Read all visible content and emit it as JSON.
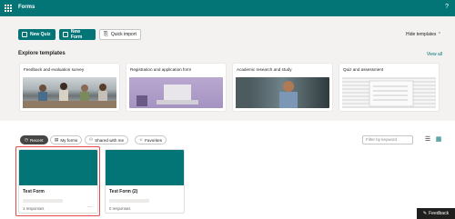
{
  "app": {
    "title": "Forms"
  },
  "toolbar": {
    "new_quiz": "New Quiz",
    "new_form": "New Form",
    "quick_import": "Quick import",
    "hide_templates": "Hide templates"
  },
  "templates": {
    "title": "Explore templates",
    "view_all": "View all",
    "items": [
      {
        "label": "Feedback and evaluation survey"
      },
      {
        "label": "Registration and application form"
      },
      {
        "label": "Academic research and study"
      },
      {
        "label": "Quiz and assessment"
      }
    ]
  },
  "filters": {
    "tabs": [
      {
        "label": "Recent",
        "active": true
      },
      {
        "label": "My forms",
        "active": false
      },
      {
        "label": "Shared with me",
        "active": false
      },
      {
        "label": "Favorites",
        "active": false
      }
    ],
    "search_placeholder": "Filter by keyword"
  },
  "forms": [
    {
      "title": "Test Form",
      "responses": "1 responses"
    },
    {
      "title": "Test Form (2)",
      "responses": "0 responses"
    }
  ],
  "feedback": {
    "label": "Feedback"
  },
  "colors": {
    "brand": "#047576",
    "selection": "#e8474c"
  }
}
